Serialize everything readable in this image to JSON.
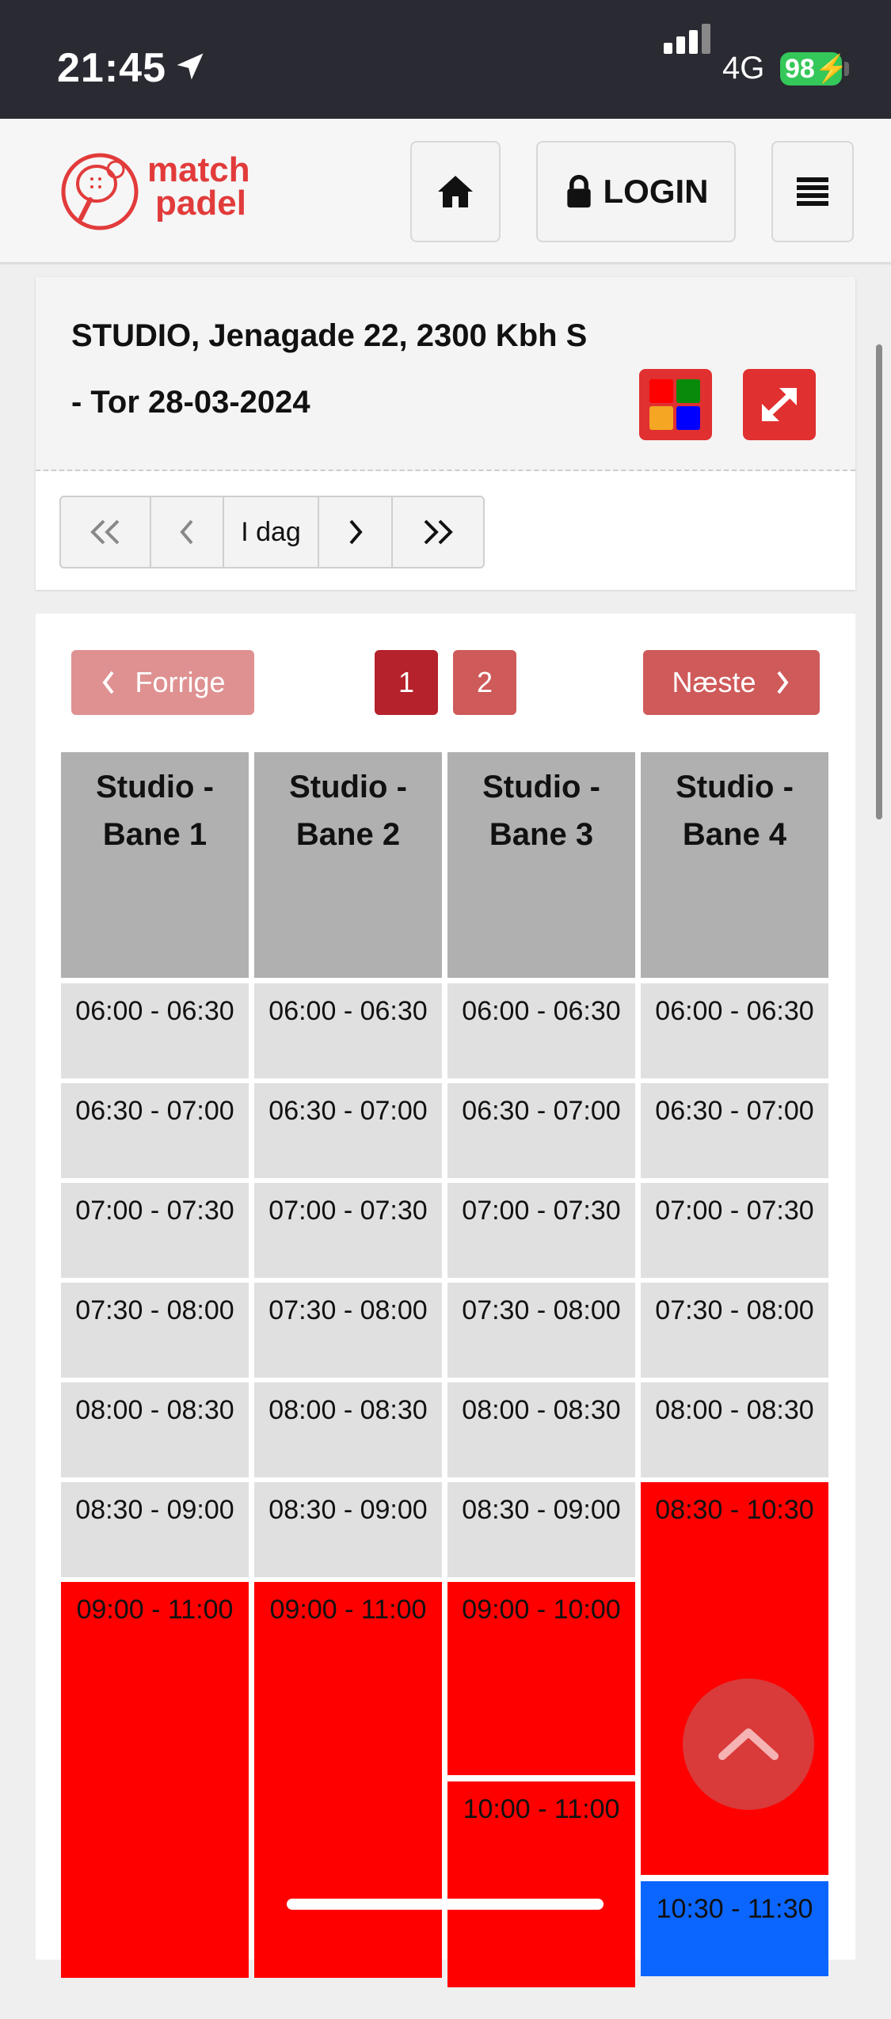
{
  "status_bar": {
    "time": "21:45",
    "network": "4G",
    "battery": "98"
  },
  "header": {
    "logo": {
      "line1": "match",
      "line2": "padel"
    },
    "home_icon": "home-icon",
    "login_label": "LOGIN",
    "menu_icon": "hamburger-icon"
  },
  "venue": {
    "title": "STUDIO, Jenagade 22, 2300 Kbh S",
    "date_line": "- Tor 28-03-2024"
  },
  "colors": {
    "brand": "#e03030",
    "booked": "#ff0000",
    "member": "#0b66ff",
    "free": "#e0e0e0",
    "header": "#b0b0b0"
  },
  "date_nav": {
    "today_label": "I dag"
  },
  "pager": {
    "prev_label": "Forrige",
    "next_label": "Næste",
    "pages": [
      "1",
      "2"
    ],
    "current_page": "1"
  },
  "courts": [
    "Studio - Bane 1",
    "Studio - Bane 2",
    "Studio - Bane 3",
    "Studio - Bane 4"
  ],
  "slots": {
    "bane1": [
      "06:00 - 06:30",
      "06:30 - 07:00",
      "07:00 - 07:30",
      "07:30 - 08:00",
      "08:00 - 08:30",
      "08:30 - 09:00",
      "09:00 - 11:00"
    ],
    "bane2": [
      "06:00 - 06:30",
      "06:30 - 07:00",
      "07:00 - 07:30",
      "07:30 - 08:00",
      "08:00 - 08:30",
      "08:30 - 09:00",
      "09:00 - 11:00"
    ],
    "bane3": [
      "06:00 - 06:30",
      "06:30 - 07:00",
      "07:00 - 07:30",
      "07:30 - 08:00",
      "08:00 - 08:30",
      "08:30 - 09:00",
      "09:00 - 10:00",
      "10:00 - 11:00"
    ],
    "bane4": [
      "06:00 - 06:30",
      "06:30 - 07:00",
      "07:00 - 07:30",
      "07:30 - 08:00",
      "08:00 - 08:30",
      "08:30 - 10:30",
      "10:30 - 11:30"
    ]
  }
}
